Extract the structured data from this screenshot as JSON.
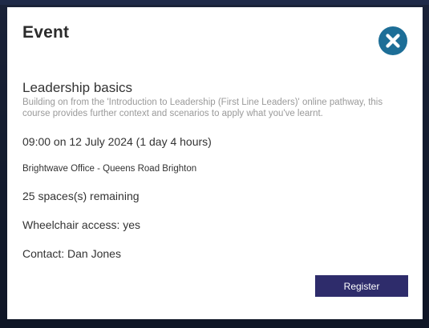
{
  "modal": {
    "title": "Event",
    "close_icon": "close-x-circle-icon"
  },
  "event": {
    "course_title": "Leadership basics",
    "description": "Building on from the 'Introduction to Leadership (First Line Leaders)' online pathway, this course provides further context and scenarios to apply what you've learnt.",
    "datetime": "09:00 on 12 July 2024 (1 day 4 hours)",
    "location": "Brightwave Office - Queens Road Brighton",
    "spaces": "25 spaces(s) remaining",
    "wheelchair": "Wheelchair access: yes",
    "contact": "Contact: Dan Jones"
  },
  "actions": {
    "register_label": "Register"
  },
  "colors": {
    "accent": "#1d6e97",
    "button": "#2e2c6b",
    "overlay": "#141b2e"
  }
}
